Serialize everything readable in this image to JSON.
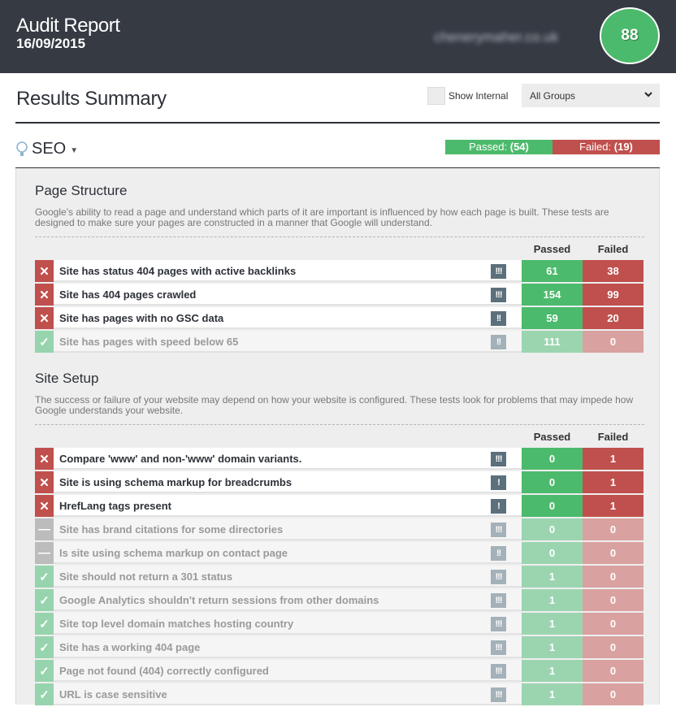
{
  "header": {
    "title": "Audit Report",
    "date": "16/09/2015",
    "domain": "chenerymaher.co.uk",
    "score": "88"
  },
  "summary": {
    "title": "Results Summary",
    "show_internal_label": "Show Internal",
    "show_internal_checked": false,
    "group_select_value": "All Groups"
  },
  "category": {
    "name": "SEO",
    "passed_label": "Passed:",
    "passed_count": "(54)",
    "failed_label": "Failed:",
    "failed_count": "(19)"
  },
  "colors": {
    "passed": "#4cba6c",
    "failed": "#c0504d",
    "header_bg": "#353a43"
  },
  "column_headers": {
    "passed": "Passed",
    "failed": "Failed"
  },
  "sections": [
    {
      "title": "Page Structure",
      "description": "Google's ability to read a page and understand which parts of it are important is influenced by how each page is built. These tests are designed to make sure your pages are constructed in a manner that Google will understand.",
      "tests": [
        {
          "status": "failed",
          "label": "Site has status 404 pages with active backlinks",
          "priority": "!!!",
          "passed": "61",
          "failed": "38"
        },
        {
          "status": "failed",
          "label": "Site has 404 pages crawled",
          "priority": "!!!",
          "passed": "154",
          "failed": "99"
        },
        {
          "status": "failed",
          "label": "Site has pages with no GSC data",
          "priority": "!!",
          "passed": "59",
          "failed": "20"
        },
        {
          "status": "ok",
          "label": "Site has pages with speed below 65",
          "priority": "!!",
          "passed": "111",
          "failed": "0"
        }
      ]
    },
    {
      "title": "Site Setup",
      "description": "The success or failure of your website may depend on how your website is configured. These tests look for problems that may impede how Google understands your website.",
      "tests": [
        {
          "status": "failed",
          "label": "Compare 'www' and non-'www' domain variants.",
          "priority": "!!!",
          "passed": "0",
          "failed": "1"
        },
        {
          "status": "failed",
          "label": "Site is using schema markup for breadcrumbs",
          "priority": "!",
          "passed": "0",
          "failed": "1"
        },
        {
          "status": "failed",
          "label": "HrefLang tags present",
          "priority": "!",
          "passed": "0",
          "failed": "1"
        },
        {
          "status": "na",
          "label": "Site has brand citations for some directories",
          "priority": "!!!",
          "passed": "0",
          "failed": "0"
        },
        {
          "status": "na",
          "label": "Is site using schema markup on contact page",
          "priority": "!!",
          "passed": "0",
          "failed": "0"
        },
        {
          "status": "ok",
          "label": "Site should not return a 301 status",
          "priority": "!!!",
          "passed": "1",
          "failed": "0"
        },
        {
          "status": "ok",
          "label": "Google Analytics shouldn't return sessions from other domains",
          "priority": "!!!",
          "passed": "1",
          "failed": "0"
        },
        {
          "status": "ok",
          "label": "Site top level domain matches hosting country",
          "priority": "!!!",
          "passed": "1",
          "failed": "0"
        },
        {
          "status": "ok",
          "label": "Site has a working 404 page",
          "priority": "!!!",
          "passed": "1",
          "failed": "0"
        },
        {
          "status": "ok",
          "label": "Page not found (404) correctly configured",
          "priority": "!!!",
          "passed": "1",
          "failed": "0"
        },
        {
          "status": "ok",
          "label": "URL is case sensitive",
          "priority": "!!!",
          "passed": "1",
          "failed": "0"
        }
      ]
    }
  ],
  "status_icons": {
    "failed": "✕",
    "ok": "✓",
    "na": "—"
  }
}
